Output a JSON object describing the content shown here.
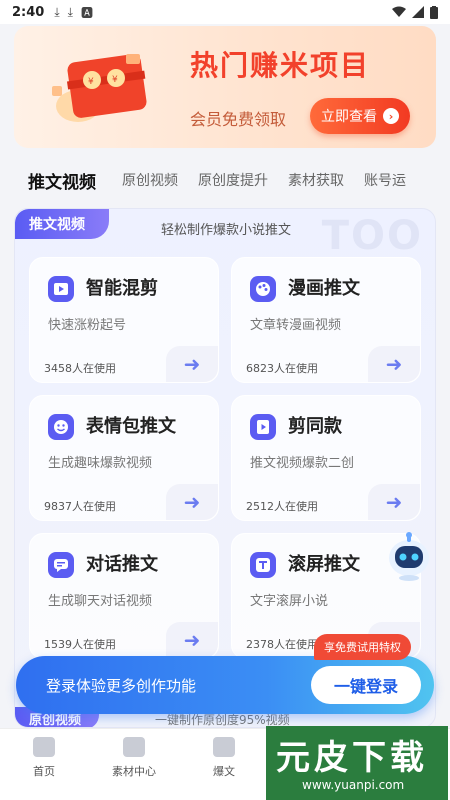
{
  "status_bar": {
    "time": "2:40",
    "icons": [
      "download-icon",
      "download-icon",
      "text-a-icon"
    ],
    "right_icons": [
      "wifi-icon",
      "signal-icon",
      "battery-icon"
    ]
  },
  "banner": {
    "title": "热门赚米项目",
    "subtitle": "会员免费领取",
    "cta_label": "立即查看",
    "cta_icon": "chevron-right-icon"
  },
  "tabs": [
    {
      "label": "推文视频",
      "active": true
    },
    {
      "label": "原创视频"
    },
    {
      "label": "原创度提升"
    },
    {
      "label": "素材获取"
    },
    {
      "label": "账号运"
    }
  ],
  "section": {
    "tag": "推文视频",
    "description": "轻松制作爆款小说推文",
    "watermark": "TOO"
  },
  "cards": [
    {
      "title": "智能混剪",
      "desc": "快速涨粉起号",
      "users": "3458人在使用",
      "icon": "video-clip-icon"
    },
    {
      "title": "漫画推文",
      "desc": "文章转漫画视频",
      "users": "6823人在使用",
      "icon": "palette-icon"
    },
    {
      "title": "表情包推文",
      "desc": "生成趣味爆款视频",
      "users": "9837人在使用",
      "icon": "emoji-face-icon"
    },
    {
      "title": "剪同款",
      "desc": "推文视频爆款二创",
      "users": "2512人在使用",
      "icon": "film-play-icon"
    },
    {
      "title": "对话推文",
      "desc": "生成聊天对话视频",
      "users": "1539人在使用",
      "icon": "chat-bubble-icon"
    },
    {
      "title": "滚屏推文",
      "desc": "文字滚屏小说",
      "users": "2378人在使用",
      "icon": "text-scroll-icon"
    }
  ],
  "next_section": {
    "tag": "原创视频",
    "description": "一键制作原创度95%视频"
  },
  "login_bar": {
    "text": "登录体验更多创作功能",
    "button": "一键登录",
    "badge": "享免费试用特权"
  },
  "bottom_nav": [
    {
      "label": "首页",
      "icon": "home-icon"
    },
    {
      "label": "素材中心",
      "icon": "folder-icon"
    },
    {
      "label": "爆文",
      "icon": "tv-icon"
    }
  ],
  "site_logo": {
    "text": "元皮下载",
    "url": "www.yuanpi.com"
  }
}
